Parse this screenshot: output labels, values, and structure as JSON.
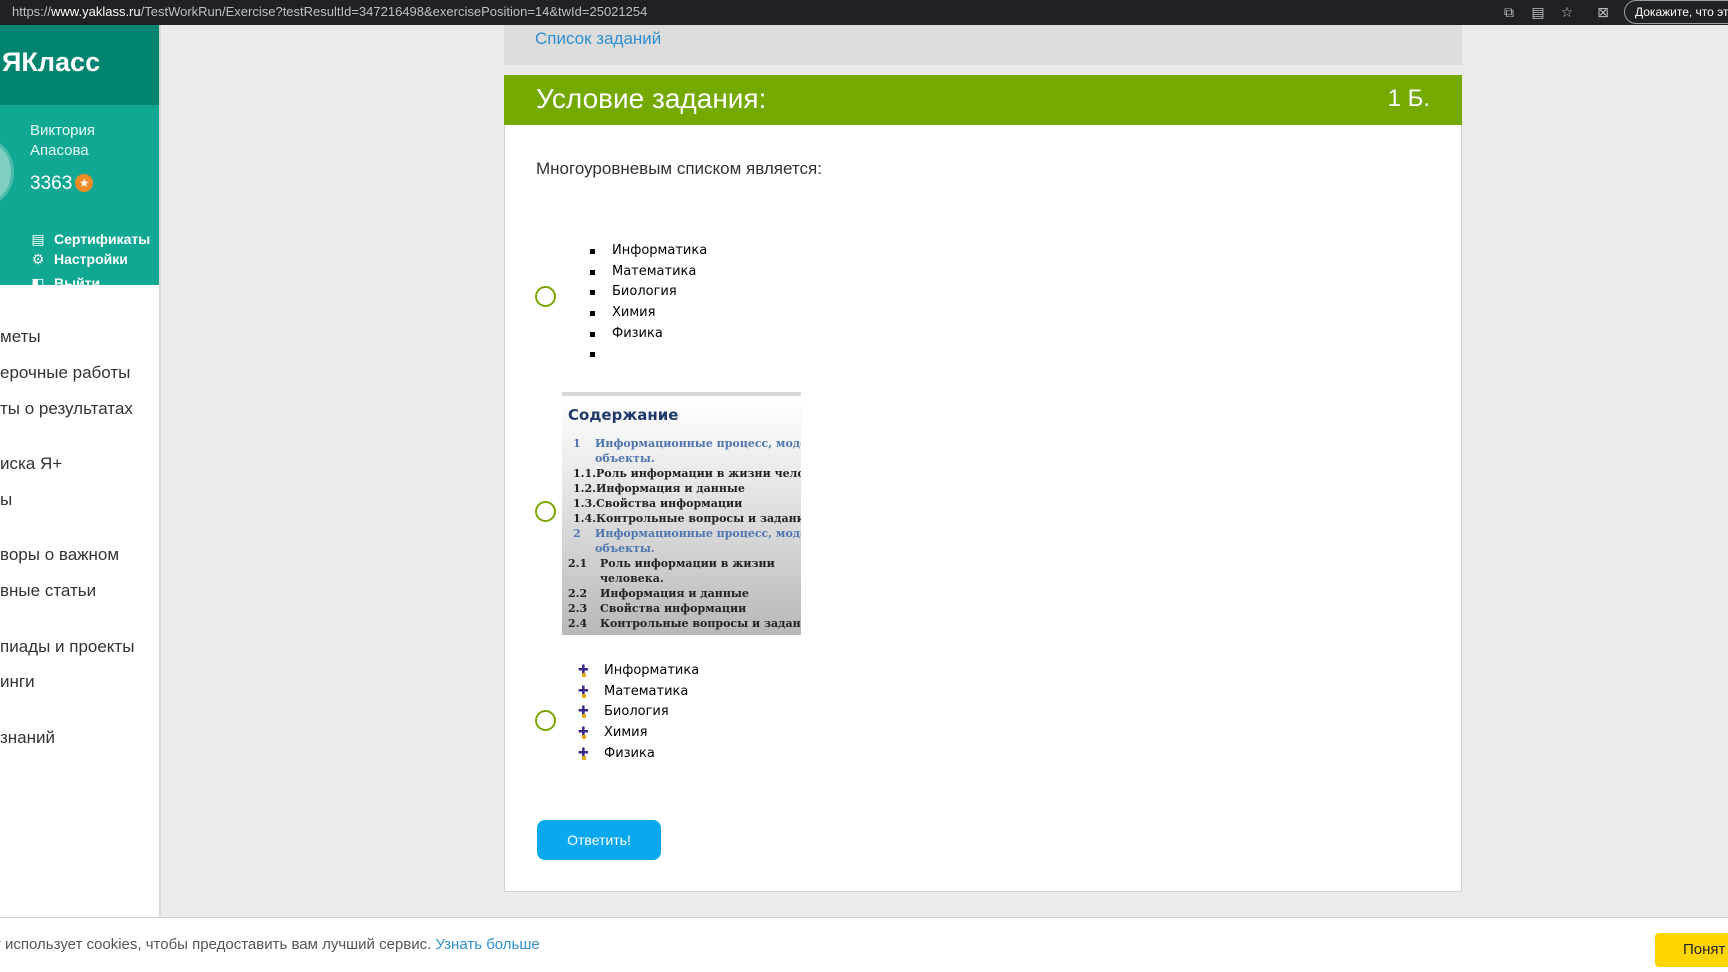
{
  "browser": {
    "url_prefix": "https://",
    "url_host": "www.yaklass.ru",
    "url_path": "/TestWorkRun/Exercise?testResultId=347216498&exercisePosition=14&twId=25021254",
    "extension_text": "Докажите, что эт"
  },
  "sidebar": {
    "brand": "ЯКласс",
    "user_name": "Виктория Апасова",
    "points": "3363",
    "links": {
      "certificates": "Сертификаты",
      "settings": "Настройки",
      "logout": "Выйти"
    },
    "nav": [
      "меты",
      "ерочные работы",
      "ты о результатах",
      "иска Я+",
      "ы",
      "воры о важном",
      "вные статьи",
      "пиады и проекты",
      "инги",
      "знаний"
    ]
  },
  "main": {
    "tasks_link": "Список заданий",
    "header_title": "Условие задания:",
    "header_points": "1 Б.",
    "question": "Многоуровневым списком является:",
    "option1_items": [
      "Информатика",
      "Математика",
      "Биология",
      "Химия",
      "Физика",
      ""
    ],
    "toc": {
      "title": "Содержание",
      "rows": [
        {
          "num": "1",
          "text": "Информационные процесс, модели,",
          "level": "top"
        },
        {
          "num": "",
          "text": "объекты.",
          "level": "top"
        },
        {
          "num": "1.1.",
          "text": "Роль информации в жизни человека.",
          "level": "sub"
        },
        {
          "num": "1.2.",
          "text": "Информация и данные",
          "level": "sub"
        },
        {
          "num": "1.3.",
          "text": "Свойства информации",
          "level": "sub"
        },
        {
          "num": "1.4.",
          "text": "Контрольные вопросы и задания",
          "level": "sub"
        },
        {
          "num": "2",
          "text": "Информационные процесс, модели,",
          "level": "top"
        },
        {
          "num": "",
          "text": "объекты.",
          "level": "top"
        },
        {
          "num": "2.1",
          "text": "Роль информации в жизни",
          "level": "sub2"
        },
        {
          "num": "",
          "text": "человека.",
          "level": "sub2"
        },
        {
          "num": "2.2",
          "text": "Информация и данные",
          "level": "sub2"
        },
        {
          "num": "2.3",
          "text": "Свойства информации",
          "level": "sub2"
        },
        {
          "num": "2.4",
          "text": "Контрольные вопросы и задания",
          "level": "sub2"
        }
      ]
    },
    "option3_items": [
      "Информатика",
      "Математика",
      "Биология",
      "Химия",
      "Физика"
    ],
    "answer_button": "Ответить!"
  },
  "cookie": {
    "text": "т использует cookies, чтобы предоставить вам лучший сервис.",
    "link": "Узнать больше",
    "button": "Понят"
  },
  "colors": {
    "brand_dark": "#00836f",
    "brand": "#11a893",
    "header_green": "#74a900",
    "button_blue": "#0aa8ee",
    "link_blue": "#2f8fd0",
    "cookie_yellow": "#ffd500"
  }
}
